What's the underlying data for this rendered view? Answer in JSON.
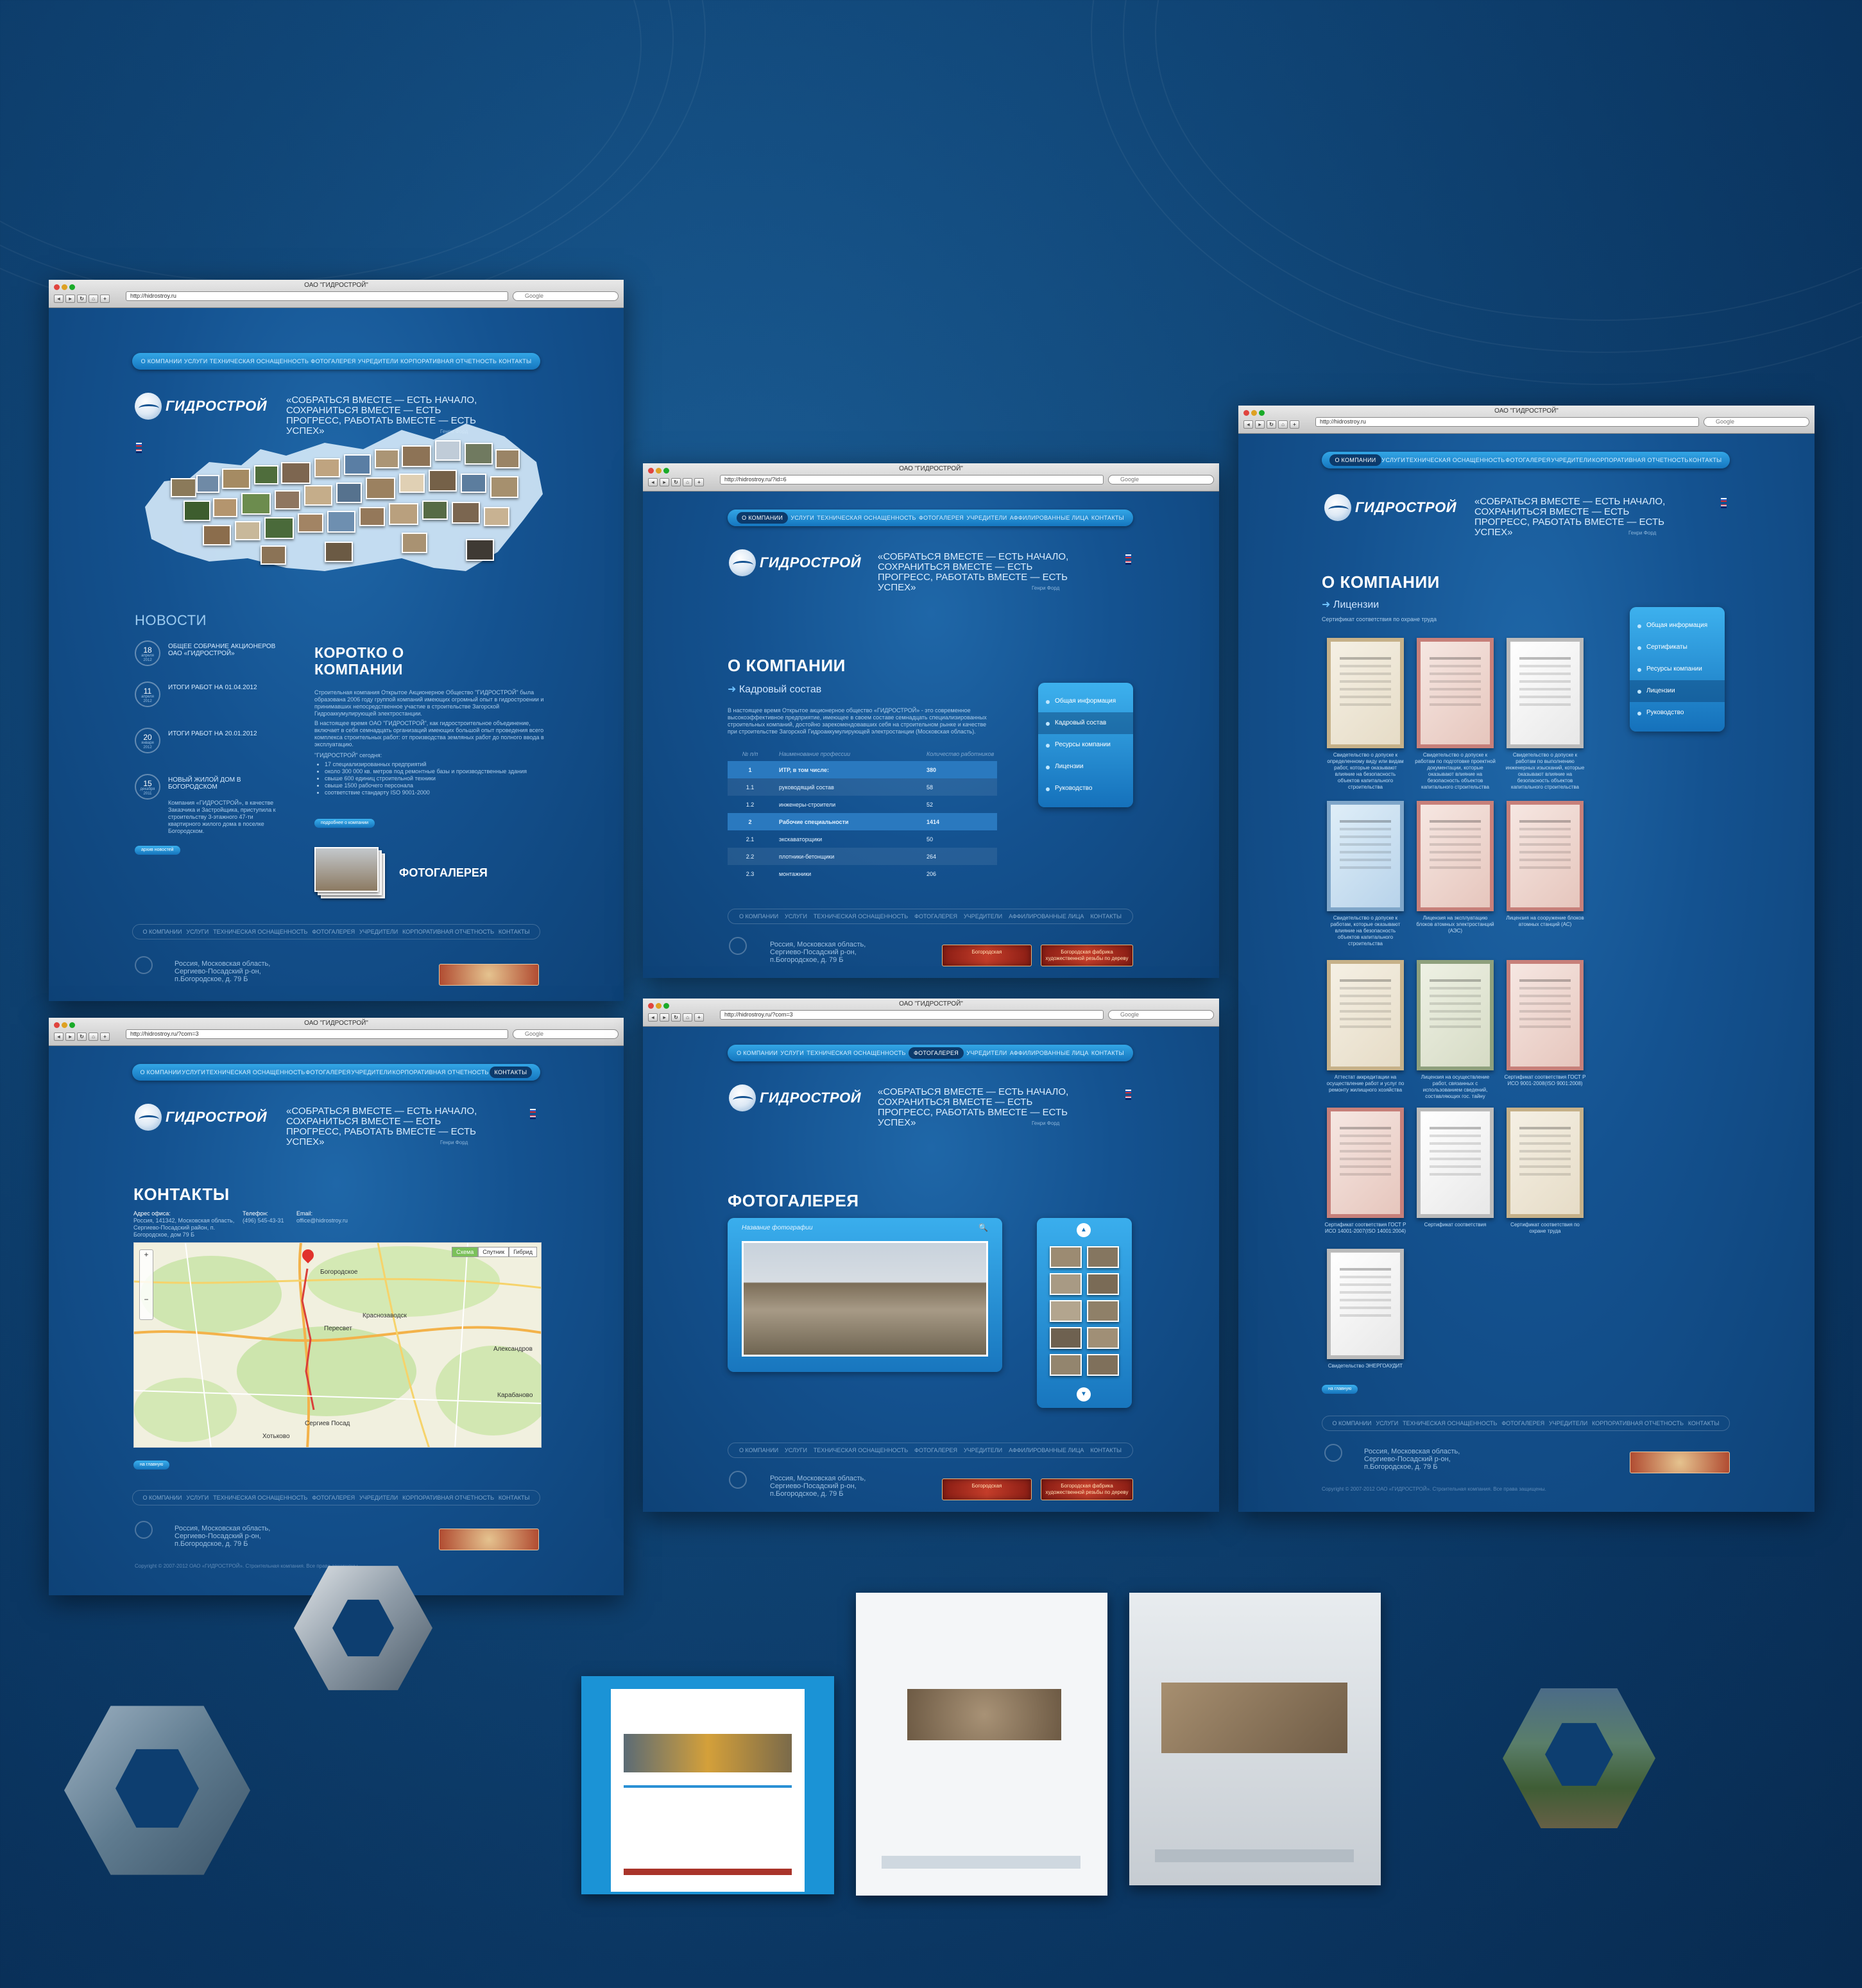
{
  "colors": {
    "bg": "#0e4477",
    "accent": "#2ea3e6"
  },
  "site": {
    "window_title": "ОАО \"ГИДРОСТРОЙ\"",
    "search_placeholder": "Google",
    "logo": "ГИДРОСТРОЙ",
    "slogan": "«СОБРАТЬСЯ ВМЕСТЕ — ЕСТЬ НАЧАЛО, СОХРАНИТЬСЯ ВМЕСТЕ — ЕСТЬ ПРОГРЕСС, РАБОТАТЬ ВМЕСТЕ — ЕСТЬ УСПЕХ»",
    "slogan_author": "Генри Форд",
    "menu": [
      "О КОМПАНИИ",
      "УСЛУГИ",
      "ТЕХНИЧЕСКАЯ ОСНАЩЕННОСТЬ",
      "ФОТОГАЛЕРЕЯ",
      "УЧРЕДИТЕЛИ",
      "АФФИЛИРОВАННЫЕ ЛИЦА",
      "КОРПОРАТИВНАЯ ОТЧЕТНОСТЬ",
      "КОНТАКТЫ"
    ],
    "menu_home": [
      "О КОМПАНИИ",
      "УСЛУГИ",
      "ТЕХНИЧЕСКАЯ ОСНАЩЕННОСТЬ",
      "ФОТОГАЛЕРЕЯ",
      "УЧРЕДИТЕЛИ",
      "КОРПОРАТИВНАЯ ОТЧЕТНОСТЬ",
      "КОНТАКТЫ"
    ],
    "address": "Россия, Московская область, Сергиево-Посадский р-он, п.Богородское, д. 79 Б",
    "copyright": "Copyright © 2007-2012 ОАО «ГИДРОСТРОЙ». Строительная компания. Все права защищены.",
    "banner1": "Богородская",
    "banner2": "Богородская фабрика художественной резьбы по дереву"
  },
  "home": {
    "url": "http://hidrostroy.ru",
    "news_title": "НОВОСТИ",
    "news": [
      {
        "day": "18",
        "month": "апреля",
        "year": "2012",
        "title": "ОБЩЕЕ СОБРАНИЕ АКЦИОНЕРОВ ОАО «ГИДРОСТРОЙ»"
      },
      {
        "day": "11",
        "month": "апреля",
        "year": "2012",
        "title": "ИТОГИ РАБОТ НА 01.04.2012"
      },
      {
        "day": "20",
        "month": "января",
        "year": "2012",
        "title": "ИТОГИ РАБОТ НА 20.01.2012"
      },
      {
        "day": "15",
        "month": "декабря",
        "year": "2011",
        "title": "НОВЫЙ ЖИЛОЙ ДОМ В БОГОРОДСКОМ"
      }
    ],
    "news_text": "Компания «ГИДРОСТРОЙ», в качестве Заказчика и Застройщика, приступила к строительству 3-этажного 47-ти квартирного жилого дома в поселке Богородском.",
    "all_news": "архив новостей",
    "about_title": "КОРОТКО О КОМПАНИИ",
    "about_p1": "Строительная компания Открытое Акционерное Общество \"ГИДРОСТРОЙ\" была образована 2006 году группой компаний имеющих огромный опыт в гидростроении и принимавших непосредственное участие в строительстве Загорской Гидроаккумулирующей электростанции.",
    "about_p2": "В настоящее время ОАО \"ГИДРОСТРОЙ\", как гидростроительное объединение, включает в себя семнадцать организаций имеющих большой опыт проведения всего комплекса строительных работ: от производства земляных работ до полного ввода в эксплуатацию.",
    "about_list_title": "\"ГИДРОСТРОЙ\" сегодня:",
    "about_list": [
      "17 специализированных предприятий",
      "около 300 000 кв. метров под ремонтные базы и производственные здания",
      "свыше 600 единиц строительной техники",
      "свыше 1500 рабочего персонала",
      "соответствие стандарту ISO 9001-2000"
    ],
    "about_more": "подробнее о компании",
    "gallery": "ФОТОГАЛЕРЕЯ"
  },
  "staff": {
    "url": "http://hidrostroy.ru/?id=6",
    "title": "О КОМПАНИИ",
    "sub": "Кадровый состав",
    "intro": "В настоящее время Открытое акционерное общество «ГИДРОСТРОЙ» - это современное высокоэффективное предприятие, имеющее в своем составе семнадцать специализированных строительных компаний, достойно зарекомендовавших себя на строительном рынке и качестве при строительстве Загорской Гидроаккумулирующей электростанции (Московская область).",
    "columns": [
      "№ п/п",
      "Наименование профессии",
      "Количество работников"
    ],
    "rows": [
      {
        "n": "1",
        "name": "ИТР, в том числе:",
        "cnt": "380",
        "bold": true
      },
      {
        "n": "1.1",
        "name": "руководящий состав",
        "cnt": "58"
      },
      {
        "n": "1.2",
        "name": "инженеры-строители",
        "cnt": "52"
      },
      {
        "n": "2",
        "name": "Рабочие специальности",
        "cnt": "1414",
        "bold": true
      },
      {
        "n": "2.1",
        "name": "экскаваторщики",
        "cnt": "50"
      },
      {
        "n": "2.2",
        "name": "плотники-бетонщики",
        "cnt": "264"
      },
      {
        "n": "2.3",
        "name": "монтажники",
        "cnt": "206"
      }
    ],
    "side": [
      "Общая информация",
      "Кадровый состав",
      "Ресурсы компании",
      "Лицензии",
      "Руководство"
    ]
  },
  "licenses": {
    "url": "http://hidrostroy.ru",
    "title": "О КОМПАНИИ",
    "sub": "Лицензии",
    "note": "Сертификат соответствия по охране труда",
    "side": [
      "Общая информация",
      "Сертификаты",
      "Ресурсы компании",
      "Лицензии",
      "Руководство"
    ],
    "certs": [
      "Свидетельство о допуске к определенному виду или видам работ, которые оказывают влияние на безопасность объектов капитального строительства",
      "Свидетельство о допуске к работам по подготовке проектной документации, которые оказывают влияние на безопасность объектов капитального строительства",
      "Свидетельство о допуске к работам по выполнению инженерных изысканий, которые оказывают влияние на безопасность объектов капитального строительства",
      "Свидетельство о допуске к работам, которые оказывают влияние на безопасность объектов капитального строительства",
      "Лицензия на эксплуатацию блоков атомных электростанций (АЭС)",
      "Лицензия на сооружение блоков атомных станций (АС)",
      "Аттестат аккредитации на осуществление работ и услуг по ремонту жилищного хозяйства",
      "Лицензия на осуществление работ, связанных с использованием сведений, составляющих гос. тайну",
      "Сертификат соответствия ГОСТ Р ИСО 9001-2008(ISO 9001:2008)",
      "Сертификат соответствия ГОСТ Р ИСО 14001-2007(ISO 14001:2004)",
      "Сертификат соответствия",
      "Сертификат соответствия по охране труда",
      "Свидетельство ЭНЕРГОАУДИТ"
    ],
    "back": "на главную"
  },
  "contacts": {
    "url": "http://hidrostroy.ru/?com=3",
    "title": "КОНТАКТЫ",
    "addr_label": "Адрес офиса:",
    "addr": "Россия, 141342, Московская область, Сергиево-Посадский район, п. Богородское, дом 79 Б",
    "phone_label": "Телефон:",
    "phone": "(496) 545-43-31",
    "email_label": "Email:",
    "email": "office@hidrostroy.ru",
    "map_btns": [
      "Схема",
      "Спутник",
      "Гибрид"
    ],
    "places": [
      "Пересвет",
      "Краснозаводск",
      "Сергиев Посад",
      "Хотьково",
      "Александров",
      "Карабаново",
      "Богородское"
    ],
    "back": "на главную"
  },
  "gallery": {
    "url": "http://hidrostroy.ru/?com=3",
    "title": "ФОТОГАЛЕРЕЯ",
    "caption": "Название фотографии"
  }
}
